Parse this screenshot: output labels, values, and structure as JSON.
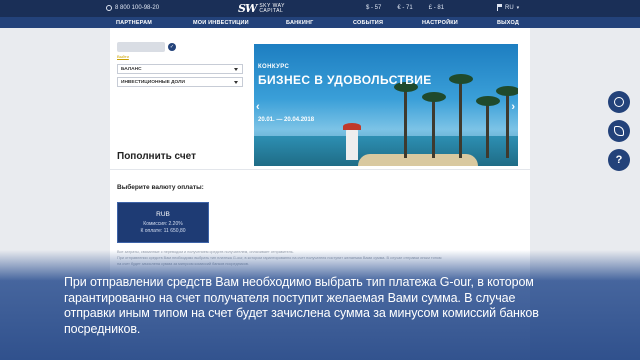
{
  "header": {
    "phone": "8 800 100-98-20",
    "logo_mark": "SW",
    "logo_line1": "SKY WAY",
    "logo_line2": "CAPITAL",
    "rates": [
      "$ - 57",
      "€ - 71",
      "£ - 81"
    ],
    "language": "RU"
  },
  "nav": {
    "items": [
      "ПАРТНЕРАМ",
      "МОИ ИНВЕСТИЦИИ",
      "БАНКИНГ",
      "СОБЫТИЯ",
      "НАСТРОЙКИ",
      "ВЫХОД"
    ]
  },
  "sidebar": {
    "small_link": "Выйти",
    "select_balance": "БАЛАНС",
    "select_investments": "ИНВЕСТИЦИОННЫЕ ДОЛИ"
  },
  "banner": {
    "kicker": "КОНКУРС",
    "title": "БИЗНЕС В УДОВОЛЬСТВИЕ",
    "dates": "20.01. — 20.04.2018",
    "prev_arrow": "‹",
    "next_arrow": "›"
  },
  "main": {
    "title": "Пополнить счет",
    "currency_label": "Выберите валюту оплаты:",
    "currency": {
      "code": "RUB",
      "commission": "Комиссия: 2.20%",
      "to_pay": "К оплате: 11 650,80"
    },
    "footnotes": [
      "Все затраты, связанные с переводом и получением средств получателем, оплачивает отправитель.",
      "При отправлении средств Вам необходимо выбрать тип платежа G-our, в котором гарантированно на счет получателя поступит желаемая Вами сумма. В случае отправки иным типом",
      "на счет будет зачислена сумма за минусом комиссий банков посредников."
    ]
  },
  "fabs": {
    "help_glyph": "?"
  },
  "subtitle": {
    "text": "При отправлении средств Вам необходимо выбрать тип платежа G-our, в котором гарантированно на счет получателя поступит желаемая Вами сумма. В случае отправки иным типом на счет будет зачислена сумма за минусом комиссий банков посредников."
  },
  "colors": {
    "top_bar": "#1a2f57",
    "nav_bar": "#23427a",
    "accent": "#1e3b74"
  }
}
